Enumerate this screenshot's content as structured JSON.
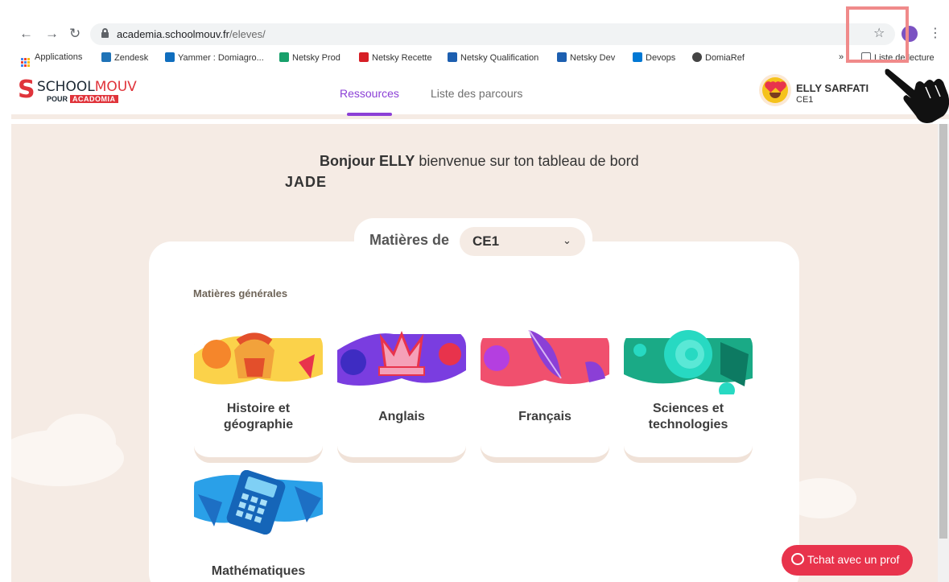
{
  "browser": {
    "url_domain": "academia.schoolmouv.fr",
    "url_path": "/eleves/",
    "bookmarks": [
      {
        "label": "Applications",
        "color": "#4285f4"
      },
      {
        "label": "Zendesk",
        "color": "#1f73b7"
      },
      {
        "label": "Yammer : Domiagro...",
        "color": "#106ebe"
      },
      {
        "label": "Netsky Prod",
        "color": "#18a06b"
      },
      {
        "label": "Netsky Recette",
        "color": "#d61f26"
      },
      {
        "label": "Netsky Qualification",
        "color": "#1d5fb0"
      },
      {
        "label": "Netsky Dev",
        "color": "#1d5fb0"
      },
      {
        "label": "Devops",
        "color": "#0078d4"
      },
      {
        "label": "DomiaRef",
        "color": "#444444"
      }
    ],
    "overflow": "»",
    "reading_list": "Liste de lecture"
  },
  "brand": {
    "schoolmouv_school": "SCHOOL",
    "schoolmouv_mouv": "MOUV",
    "pour": "POUR",
    "academia": "ACADOMIA",
    "accent": "#e0343b"
  },
  "nav": {
    "tabs": [
      {
        "label": "Ressources",
        "active": true
      },
      {
        "label": "Liste des parcours",
        "active": false
      }
    ],
    "accent": "#8b3fd6"
  },
  "user": {
    "name": "ELLY SARFATI",
    "class": "CE1"
  },
  "dashboard": {
    "greeting_prefix": "Bonjour",
    "greeting_name": "ELLY",
    "greeting_rest": "bienvenue sur ton tableau de bord",
    "overlay_text": "JADE",
    "matieres_label": "Matières de",
    "selected_level": "CE1",
    "section_label": "Matières générales"
  },
  "subjects": [
    {
      "title": "Histoire et géographie",
      "icon": "helmet-icon"
    },
    {
      "title": "Anglais",
      "icon": "crown-icon"
    },
    {
      "title": "Français",
      "icon": "feather-icon"
    },
    {
      "title": "Sciences et technologies",
      "icon": "shell-icon"
    },
    {
      "title": "Mathématiques",
      "icon": "calculator-icon"
    }
  ],
  "chat": {
    "label": "Tchat avec un prof",
    "color": "#e8334c"
  }
}
